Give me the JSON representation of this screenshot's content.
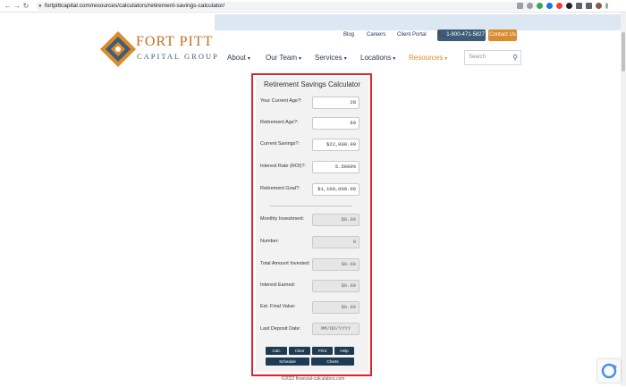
{
  "browser": {
    "url": "fortpittcapital.com/resources/calculators/retirement-savings-calculator/",
    "back": "←",
    "forward": "→",
    "reload": "↻",
    "lock": "🔒"
  },
  "header": {
    "top_links": [
      "Blog",
      "Careers",
      "Client Portal"
    ],
    "phone": "📞 1-800-471-5827",
    "contact": "Contact Us",
    "logo_title": "FORT PITT",
    "logo_sub": "CAPITAL GROUP",
    "nav": [
      "About",
      "Our Team",
      "Services",
      "Locations",
      "Resources"
    ],
    "search_placeholder": "Search",
    "colors": {
      "navy": "#243a52",
      "orange": "#d98c2c",
      "topbar": "#dbe8f1"
    }
  },
  "calculator": {
    "title": "Retirement Savings Calculator",
    "fields": [
      {
        "label": "Your Current Age?:",
        "value": "28"
      },
      {
        "label": "Retirement Age?:",
        "value": "60"
      },
      {
        "label": "Current Savings?:",
        "value": "$22,000.00"
      },
      {
        "label": "Interest Rate (ROI)?:",
        "value": "5.5000%"
      },
      {
        "label": "Retirement Goal?:",
        "value": "$1,100,000.00"
      }
    ],
    "results": [
      {
        "label": "Monthly Investment:",
        "value": "$0.00"
      },
      {
        "label": "Number:",
        "value": "0"
      },
      {
        "label": "Total Amount Invested:",
        "value": "$0.00"
      },
      {
        "label": "Interest Earned:",
        "value": "$0.00"
      },
      {
        "label": "Est. Final Value:",
        "value": "$0.00"
      },
      {
        "label": "Last Deposit Date:",
        "value": "MM/DD/YYYY"
      }
    ],
    "buttons": {
      "calc": "Calc",
      "clear": "Clear",
      "print": "Print",
      "help": "Help",
      "schedule": "Schedule",
      "charts": "Charts"
    }
  },
  "footer": {
    "credit": "©2022 financial-calculators.com"
  },
  "highlight_color": "#d8262e"
}
